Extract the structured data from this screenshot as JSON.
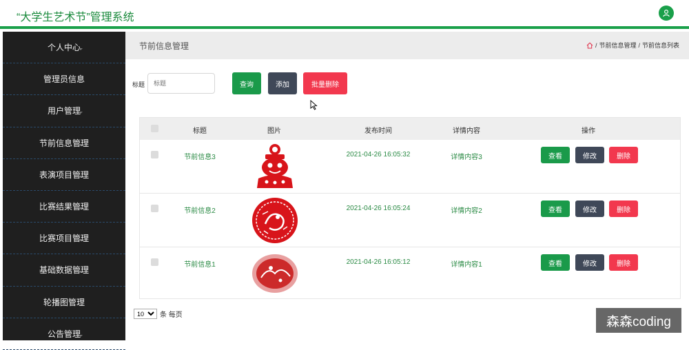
{
  "app": {
    "title": "“大学生艺术节”管理系统"
  },
  "colors": {
    "accent": "#1aa04a",
    "sidebar_bg": "#1f1f1f",
    "danger": "#f2384e",
    "dark": "#3f4858"
  },
  "sidebar": {
    "items": [
      {
        "label": "个人中心"
      },
      {
        "label": "管理员信息"
      },
      {
        "label": "用户管理"
      },
      {
        "label": "节前信息管理"
      },
      {
        "label": "表演项目管理"
      },
      {
        "label": "比赛结果管理"
      },
      {
        "label": "比赛项目管理"
      },
      {
        "label": "基础数据管理"
      },
      {
        "label": "轮播图管理"
      },
      {
        "label": "公告管理"
      }
    ]
  },
  "header": {
    "page_title": "节前信息管理",
    "breadcrumb": [
      "节前信息管理",
      "节前信息列表"
    ],
    "separator": "/"
  },
  "search": {
    "label": "标题",
    "placeholder": "标题",
    "query_label": "查询",
    "add_label": "添加",
    "batch_delete_label": "批量删除"
  },
  "table": {
    "columns": [
      "标题",
      "图片",
      "发布时间",
      "详情内容",
      "操作"
    ],
    "rows": [
      {
        "title": "节前信息3",
        "time": "2021-04-26 16:05:32",
        "detail": "详情内容3",
        "image_icon": "papercut-figure"
      },
      {
        "title": "节前信息2",
        "time": "2021-04-26 16:05:24",
        "detail": "详情内容2",
        "image_icon": "papercut-round"
      },
      {
        "title": "节前信息1",
        "time": "2021-04-26 16:05:12",
        "detail": "详情内容1",
        "image_icon": "papercut-scene"
      }
    ],
    "actions": {
      "view": "查看",
      "edit": "修改",
      "delete": "删除"
    }
  },
  "pager": {
    "page_size": "10",
    "suffix": "条 每页"
  },
  "watermark": "森森coding"
}
